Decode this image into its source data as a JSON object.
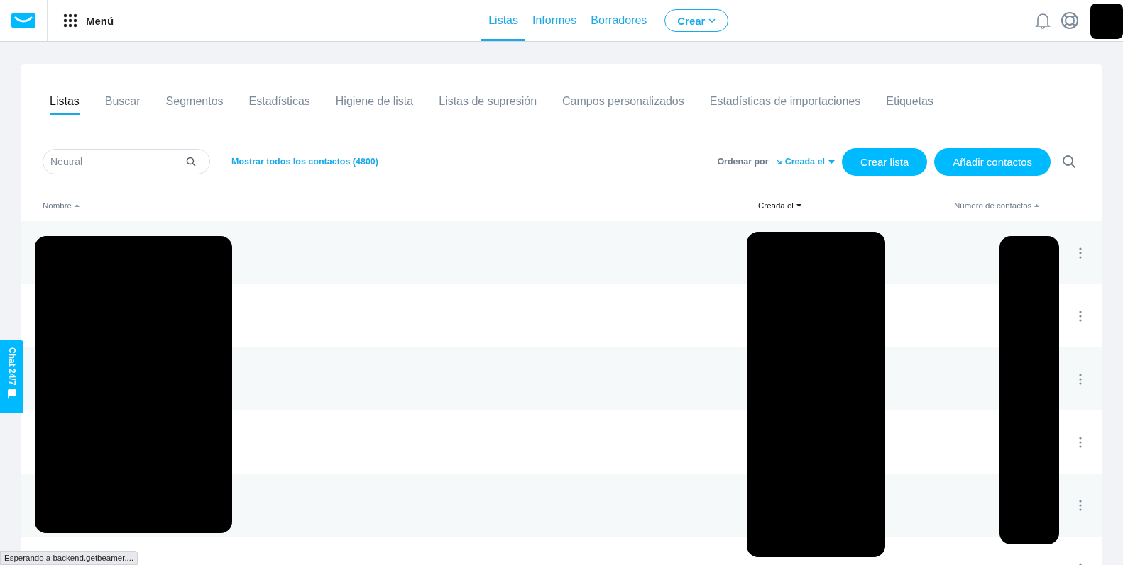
{
  "header": {
    "menu_label": "Menú",
    "nav": [
      {
        "label": "Listas",
        "selected": true
      },
      {
        "label": "Informes",
        "selected": false
      },
      {
        "label": "Borradores",
        "selected": false
      }
    ],
    "create_button": "Crear"
  },
  "tabs": [
    {
      "label": "Listas",
      "selected": true
    },
    {
      "label": "Buscar",
      "selected": false
    },
    {
      "label": "Segmentos",
      "selected": false
    },
    {
      "label": "Estadísticas",
      "selected": false
    },
    {
      "label": "Higiene de lista",
      "selected": false
    },
    {
      "label": "Listas de supresión",
      "selected": false
    },
    {
      "label": "Campos personalizados",
      "selected": false
    },
    {
      "label": "Estadísticas de importaciones",
      "selected": false
    },
    {
      "label": "Etiquetas",
      "selected": false
    }
  ],
  "search": {
    "placeholder": "Neutral"
  },
  "show_all_link": "Mostrar todos los contactos (4800)",
  "sort": {
    "label": "Ordenar por",
    "value": "Creada el"
  },
  "buttons": [
    "Crear lista",
    "Añadir contactos"
  ],
  "table": {
    "columns": [
      {
        "label": "Nombre",
        "ascending": true,
        "selected": false
      },
      {
        "label": "Creada el",
        "ascending": false,
        "selected": true
      },
      {
        "label": "Número de contactos",
        "ascending": true,
        "selected": false
      }
    ]
  },
  "chat_tab": {
    "label": "Chat 24/7"
  },
  "status_bar": "Esperando a backend.getbeamer...."
}
